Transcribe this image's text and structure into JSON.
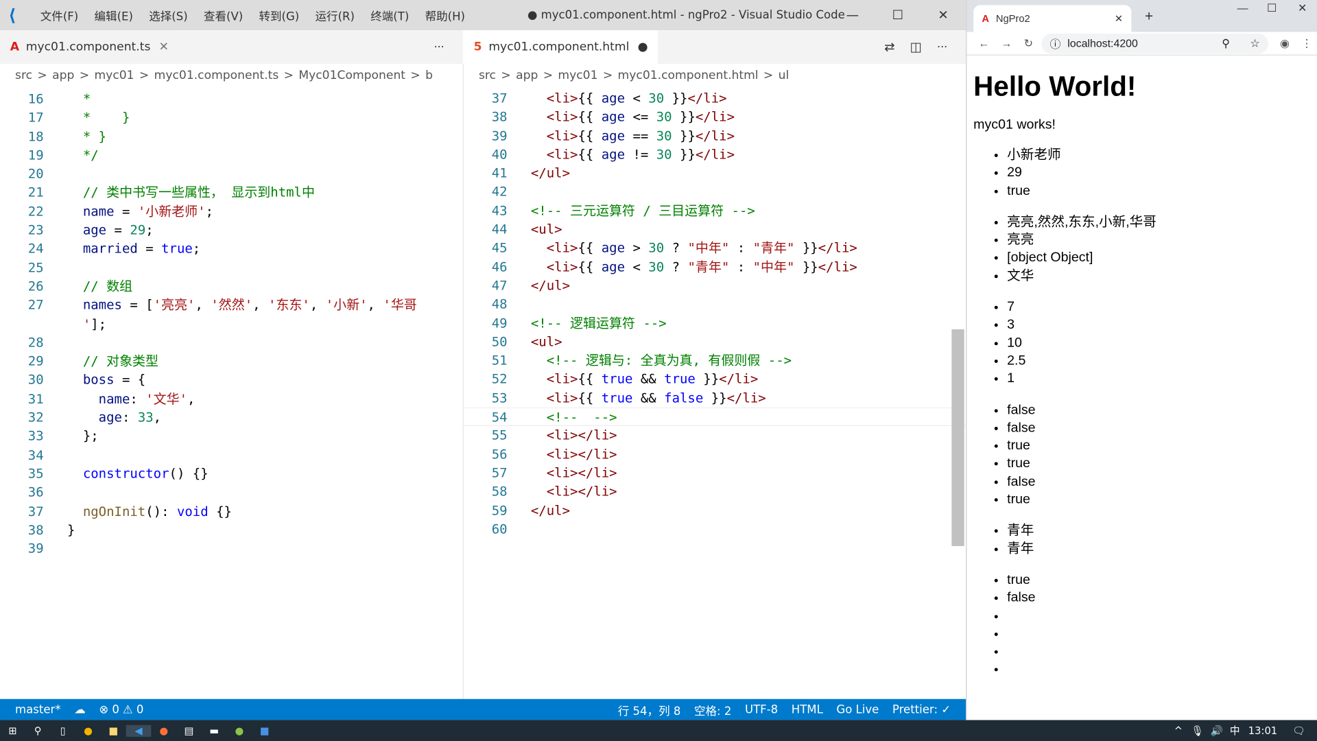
{
  "window": {
    "title": "● myc01.component.html - ngPro2 - Visual Studio Code",
    "menu": [
      "文件(F)",
      "编辑(E)",
      "选择(S)",
      "查看(V)",
      "转到(G)",
      "运行(R)",
      "终端(T)",
      "帮助(H)"
    ],
    "buttons": [
      "—",
      "☐",
      "✕"
    ]
  },
  "left": {
    "tab": "myc01.component.ts",
    "tab_close": "✕",
    "more": "···",
    "crumbs": [
      "src",
      ">",
      "app",
      ">",
      "myc01",
      ">",
      "myc01.component.ts",
      ">",
      "Myc01Component",
      ">",
      "b"
    ],
    "lines": [
      {
        "n": "16",
        "t": [
          [
            "c",
            "  *"
          ]
        ]
      },
      {
        "n": "17",
        "t": [
          [
            "c",
            "  *    }"
          ]
        ]
      },
      {
        "n": "18",
        "t": [
          [
            "c",
            "  * }"
          ]
        ]
      },
      {
        "n": "19",
        "t": [
          [
            "c",
            "  */"
          ]
        ]
      },
      {
        "n": "20",
        "t": []
      },
      {
        "n": "21",
        "t": [
          [
            "c",
            "  // 类中书写一些属性， 显示到html中"
          ]
        ]
      },
      {
        "n": "22",
        "t": [
          [
            "v",
            "  name"
          ],
          [
            "p",
            " = "
          ],
          [
            "s",
            "'小新老师'"
          ],
          [
            "p",
            ";"
          ]
        ]
      },
      {
        "n": "23",
        "t": [
          [
            "v",
            "  age"
          ],
          [
            "p",
            " = "
          ],
          [
            "n",
            "29"
          ],
          [
            "p",
            ";"
          ]
        ]
      },
      {
        "n": "24",
        "t": [
          [
            "v",
            "  married"
          ],
          [
            "p",
            " = "
          ],
          [
            "k",
            "true"
          ],
          [
            "p",
            ";"
          ]
        ]
      },
      {
        "n": "25",
        "t": []
      },
      {
        "n": "26",
        "t": [
          [
            "c",
            "  // 数组"
          ]
        ]
      },
      {
        "n": "27",
        "t": [
          [
            "v",
            "  names"
          ],
          [
            "p",
            " = ["
          ],
          [
            "s",
            "'亮亮'"
          ],
          [
            "p",
            ", "
          ],
          [
            "s",
            "'然然'"
          ],
          [
            "p",
            ", "
          ],
          [
            "s",
            "'东东'"
          ],
          [
            "p",
            ", "
          ],
          [
            "s",
            "'小新'"
          ],
          [
            "p",
            ", "
          ],
          [
            "s",
            "'华哥"
          ]
        ]
      },
      {
        "n": "",
        "t": [
          [
            "s",
            "  '"
          ],
          [
            "p",
            "];"
          ]
        ]
      },
      {
        "n": "28",
        "t": []
      },
      {
        "n": "29",
        "t": [
          [
            "c",
            "  // 对象类型"
          ]
        ]
      },
      {
        "n": "30",
        "t": [
          [
            "v",
            "  boss"
          ],
          [
            "p",
            " = {"
          ]
        ]
      },
      {
        "n": "31",
        "t": [
          [
            "v",
            "    name"
          ],
          [
            "p",
            ": "
          ],
          [
            "s",
            "'文华'"
          ],
          [
            "p",
            ","
          ]
        ]
      },
      {
        "n": "32",
        "t": [
          [
            "v",
            "    age"
          ],
          [
            "p",
            ": "
          ],
          [
            "n",
            "33"
          ],
          [
            "p",
            ","
          ]
        ]
      },
      {
        "n": "33",
        "t": [
          [
            "p",
            "  };"
          ]
        ]
      },
      {
        "n": "34",
        "t": []
      },
      {
        "n": "35",
        "t": [
          [
            "k",
            "  constructor"
          ],
          [
            "p",
            "() {}"
          ]
        ]
      },
      {
        "n": "36",
        "t": []
      },
      {
        "n": "37",
        "t": [
          [
            "f",
            "  ngOnInit"
          ],
          [
            "p",
            "(): "
          ],
          [
            "k",
            "void"
          ],
          [
            "p",
            " {}"
          ]
        ]
      },
      {
        "n": "38",
        "t": [
          [
            "p",
            "}"
          ]
        ]
      },
      {
        "n": "39",
        "t": []
      }
    ]
  },
  "right": {
    "tab": "myc01.component.html",
    "tab_dirty": "●",
    "crumbs": [
      "src",
      ">",
      "app",
      ">",
      "myc01",
      ">",
      "myc01.component.html",
      ">",
      "ul"
    ],
    "lines": [
      {
        "n": "37",
        "t": [
          [
            "t",
            "  <li>"
          ],
          [
            "p",
            "{{ "
          ],
          [
            "v",
            "age"
          ],
          [
            "p",
            " < "
          ],
          [
            "n",
            "30"
          ],
          [
            "p",
            " }}"
          ],
          [
            "t",
            "</li>"
          ]
        ]
      },
      {
        "n": "38",
        "t": [
          [
            "t",
            "  <li>"
          ],
          [
            "p",
            "{{ "
          ],
          [
            "v",
            "age"
          ],
          [
            "p",
            " <= "
          ],
          [
            "n",
            "30"
          ],
          [
            "p",
            " }}"
          ],
          [
            "t",
            "</li>"
          ]
        ]
      },
      {
        "n": "39",
        "t": [
          [
            "t",
            "  <li>"
          ],
          [
            "p",
            "{{ "
          ],
          [
            "v",
            "age"
          ],
          [
            "p",
            " == "
          ],
          [
            "n",
            "30"
          ],
          [
            "p",
            " }}"
          ],
          [
            "t",
            "</li>"
          ]
        ]
      },
      {
        "n": "40",
        "t": [
          [
            "t",
            "  <li>"
          ],
          [
            "p",
            "{{ "
          ],
          [
            "v",
            "age"
          ],
          [
            "p",
            " != "
          ],
          [
            "n",
            "30"
          ],
          [
            "p",
            " }}"
          ],
          [
            "t",
            "</li>"
          ]
        ]
      },
      {
        "n": "41",
        "t": [
          [
            "t",
            "</ul>"
          ]
        ]
      },
      {
        "n": "42",
        "t": []
      },
      {
        "n": "43",
        "t": [
          [
            "c",
            "<!-- 三元运算符 / 三目运算符 -->"
          ]
        ]
      },
      {
        "n": "44",
        "t": [
          [
            "t",
            "<ul>"
          ]
        ]
      },
      {
        "n": "45",
        "t": [
          [
            "t",
            "  <li>"
          ],
          [
            "p",
            "{{ "
          ],
          [
            "v",
            "age"
          ],
          [
            "p",
            " > "
          ],
          [
            "n",
            "30"
          ],
          [
            "p",
            " ? "
          ],
          [
            "s",
            "\"中年\""
          ],
          [
            "p",
            " : "
          ],
          [
            "s",
            "\"青年\""
          ],
          [
            "p",
            " }}"
          ],
          [
            "t",
            "</li>"
          ]
        ]
      },
      {
        "n": "46",
        "t": [
          [
            "t",
            "  <li>"
          ],
          [
            "p",
            "{{ "
          ],
          [
            "v",
            "age"
          ],
          [
            "p",
            " < "
          ],
          [
            "n",
            "30"
          ],
          [
            "p",
            " ? "
          ],
          [
            "s",
            "\"青年\""
          ],
          [
            "p",
            " : "
          ],
          [
            "s",
            "\"中年\""
          ],
          [
            "p",
            " }}"
          ],
          [
            "t",
            "</li>"
          ]
        ]
      },
      {
        "n": "47",
        "t": [
          [
            "t",
            "</ul>"
          ]
        ]
      },
      {
        "n": "48",
        "t": []
      },
      {
        "n": "49",
        "t": [
          [
            "c",
            "<!-- 逻辑运算符 -->"
          ]
        ]
      },
      {
        "n": "50",
        "t": [
          [
            "t",
            "<ul>"
          ]
        ]
      },
      {
        "n": "51",
        "t": [
          [
            "c",
            "  <!-- 逻辑与: 全真为真, 有假则假 -->"
          ]
        ]
      },
      {
        "n": "52",
        "t": [
          [
            "t",
            "  <li>"
          ],
          [
            "p",
            "{{ "
          ],
          [
            "k",
            "true"
          ],
          [
            "p",
            " && "
          ],
          [
            "k",
            "true"
          ],
          [
            "p",
            " }}"
          ],
          [
            "t",
            "</li>"
          ]
        ]
      },
      {
        "n": "53",
        "t": [
          [
            "t",
            "  <li>"
          ],
          [
            "p",
            "{{ "
          ],
          [
            "k",
            "true"
          ],
          [
            "p",
            " && "
          ],
          [
            "k",
            "false"
          ],
          [
            "p",
            " }}"
          ],
          [
            "t",
            "</li>"
          ]
        ]
      },
      {
        "n": "54",
        "t": [
          [
            "c",
            "  <!--  -->"
          ]
        ]
      },
      {
        "n": "55",
        "t": [
          [
            "t",
            "  <li></li>"
          ]
        ]
      },
      {
        "n": "56",
        "t": [
          [
            "t",
            "  <li></li>"
          ]
        ]
      },
      {
        "n": "57",
        "t": [
          [
            "t",
            "  <li></li>"
          ]
        ]
      },
      {
        "n": "58",
        "t": [
          [
            "t",
            "  <li></li>"
          ]
        ]
      },
      {
        "n": "59",
        "t": [
          [
            "t",
            "</ul>"
          ]
        ]
      },
      {
        "n": "60",
        "t": []
      }
    ]
  },
  "status": {
    "branch": "master*",
    "errors": "⊗ 0",
    "warnings": "⚠ 0",
    "position": "行 54，列 8",
    "spaces": "空格: 2",
    "encoding": "UTF-8",
    "language": "HTML",
    "golive": "Go Live",
    "prettier": "Prettier: ✓"
  },
  "taskbar": {
    "time": "13:01",
    "ime": "中"
  },
  "browser": {
    "tab": "NgPro2",
    "url": "localhost:4200",
    "heading": "Hello World!",
    "subtitle": "myc01 works!",
    "lists": [
      [
        "小新老师",
        "29",
        "true"
      ],
      [
        "亮亮,然然,东东,小新,华哥",
        "亮亮",
        "[object Object]",
        "文华"
      ],
      [
        "7",
        "3",
        "10",
        "2.5",
        "1"
      ],
      [
        "false",
        "false",
        "true",
        "true",
        "false",
        "true"
      ],
      [
        "青年",
        "青年"
      ],
      [
        "true",
        "false",
        "",
        "",
        "",
        ""
      ]
    ]
  }
}
